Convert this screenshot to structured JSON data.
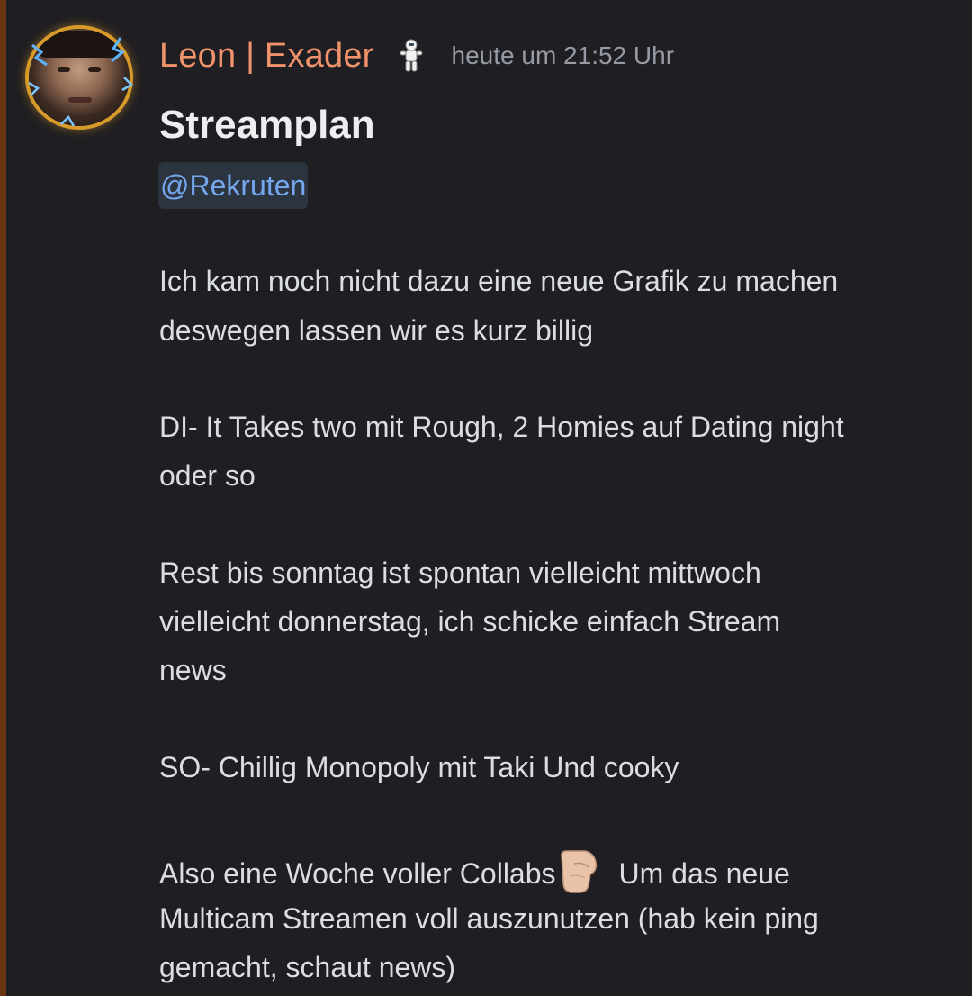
{
  "message": {
    "author": "Leon | Exader",
    "role_icon": "astronaut-icon",
    "timestamp": "heute um 21:52 Uhr",
    "title": "Streamplan",
    "mention": "@Rekruten",
    "lines": [
      "Ich kam noch nicht dazu eine neue Grafik zu machen",
      "deswegen lassen wir es kurz billig",
      "DI- It Takes two mit Rough, 2 Homies auf Dating night",
      "oder so",
      "Rest bis sonntag ist spontan vielleicht mittwoch",
      "vielleicht donnerstag, ich schicke einfach Stream",
      "news",
      "SO- Chillig Monopoly mit Taki Und cooky",
      "Also eine Woche voller Collabs",
      "Um das neue",
      "Multicam Streamen voll auszunutzen (hab kein ping",
      "gemacht, schaut news)"
    ],
    "inline_emoji": "pointing-hand-emoji"
  },
  "colors": {
    "background": "#1f1e22",
    "accent_bar": "#6b3410",
    "author": "#f0926a",
    "timestamp": "#959aa4",
    "text": "#dbdee1",
    "mention_text": "#74a7ee",
    "mention_bg": "#2c3440"
  }
}
